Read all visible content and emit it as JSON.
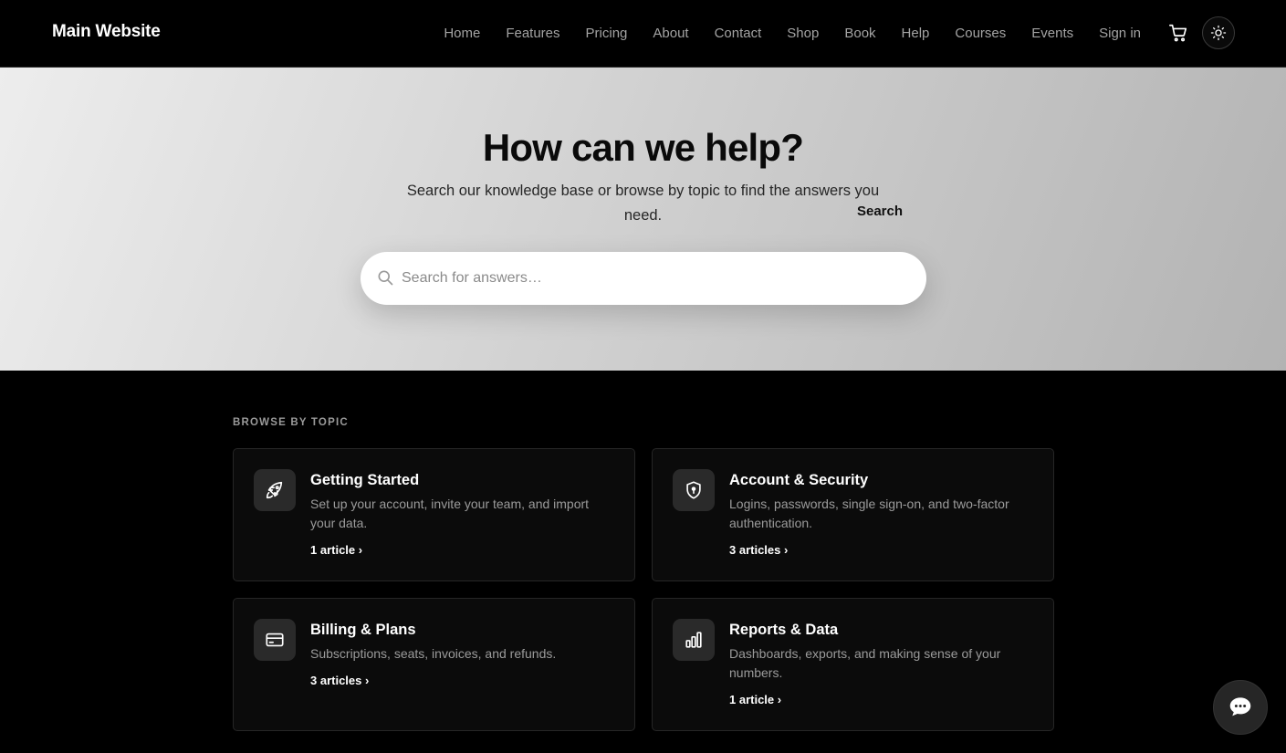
{
  "header": {
    "brand": "Main Website",
    "nav": [
      "Home",
      "Features",
      "Pricing",
      "About",
      "Contact",
      "Shop",
      "Book",
      "Help",
      "Courses",
      "Events",
      "Sign in"
    ],
    "cart_icon": "cart-icon",
    "theme_icon": "sun-icon"
  },
  "hero": {
    "title": "How can we help?",
    "subtitle": "Search our knowledge base or browse by topic to find the answers you need.",
    "search": {
      "placeholder": "Search for answers…",
      "value": "",
      "button_label": "Search",
      "icon": "search-icon"
    }
  },
  "topics": {
    "label": "BROWSE BY TOPIC",
    "cards": [
      {
        "title": "Getting Started",
        "description": "Set up your account, invite your team, and import your data.",
        "link": "1 article ›",
        "icon": "rocket-icon"
      },
      {
        "title": "Account & Security",
        "description": "Logins, passwords, single sign-on, and two-factor authentication.",
        "link": "3 articles ›",
        "icon": "shield-icon"
      },
      {
        "title": "Billing & Plans",
        "description": "Subscriptions, seats, invoices, and refunds.",
        "link": "3 articles ›",
        "icon": "credit-card-icon"
      },
      {
        "title": "Reports & Data",
        "description": "Dashboards, exports, and making sense of your numbers.",
        "link": "1 article ›",
        "icon": "bar-chart-icon"
      }
    ]
  },
  "chat": {
    "icon": "chat-bubble-icon"
  },
  "colors": {
    "header_bg": "#000000",
    "card_bg": "#0b0b0b",
    "accent": "#ffffff"
  }
}
